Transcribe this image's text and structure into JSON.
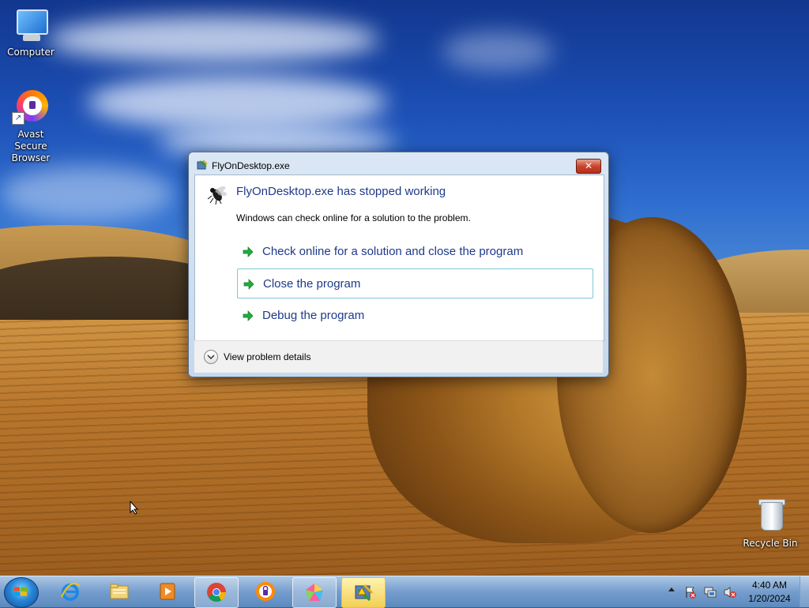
{
  "desktop": {
    "icons": [
      {
        "label": "Computer"
      },
      {
        "label": "Avast Secure Browser"
      },
      {
        "label": "Recycle Bin"
      }
    ]
  },
  "dialog": {
    "title": "FlyOnDesktop.exe",
    "close_label": "✕",
    "heading": "FlyOnDesktop.exe has stopped working",
    "message": "Windows can check online for a solution to the problem.",
    "options": [
      {
        "label": "Check online for a solution and close the program"
      },
      {
        "label": "Close the program"
      },
      {
        "label": "Debug the program"
      }
    ],
    "details_label": "View problem details"
  },
  "taskbar": {
    "pinned": [
      "internet-explorer-icon",
      "file-explorer-icon",
      "media-player-icon",
      "chrome-icon",
      "avast-browser-icon",
      "paint-app-icon",
      "error-report-icon"
    ],
    "clock": {
      "time": "4:40 AM",
      "date": "1/20/2024"
    }
  },
  "colors": {
    "heading": "#1e3a8a",
    "accent_green": "#1fae3b",
    "close_red": "#c8452f"
  }
}
